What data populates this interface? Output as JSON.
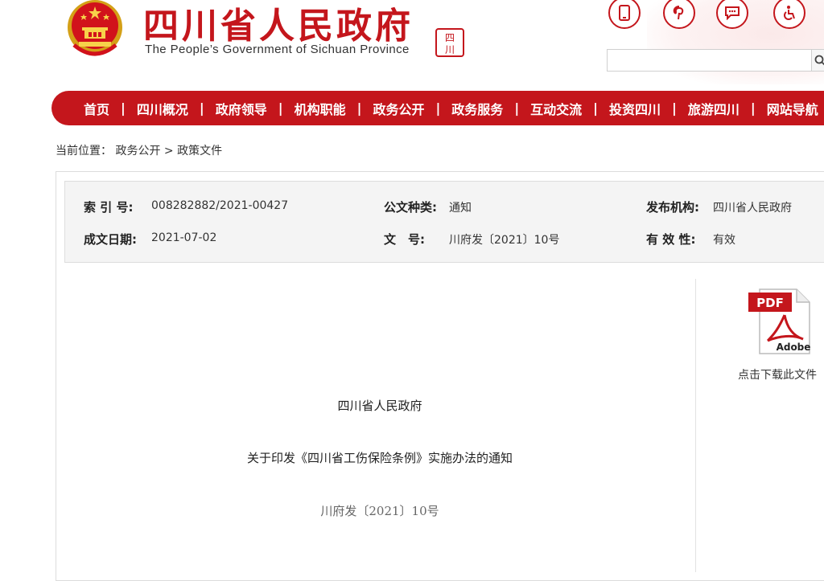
{
  "header": {
    "title": "四川省人民政府",
    "subtitle": "The People’s Government of Sichuan Province",
    "seal_text": "四川",
    "top_icons": [
      "mobile-icon",
      "pinterest-icon",
      "chat-icon",
      "accessibility-icon"
    ],
    "search": {
      "value": "",
      "placeholder": ""
    }
  },
  "nav": {
    "items": [
      "首页",
      "四川概况",
      "政府领导",
      "机构职能",
      "政务公开",
      "政务服务",
      "互动交流",
      "投资四川",
      "旅游四川",
      "网站导航"
    ],
    "separator": "|"
  },
  "breadcrumb": {
    "prefix": "当前位置：",
    "items": [
      "政务公开",
      "政策文件"
    ],
    "separator": ">"
  },
  "meta": {
    "index_label": "索 引 号:",
    "index_value": "008282882/2021-00427",
    "type_label": "公文种类:",
    "type_value": "通知",
    "issuer_label": "发布机构:",
    "issuer_value": "四川省人民政府",
    "date_label": "成文日期:",
    "date_value": "2021-07-02",
    "docno_label": "文　号:",
    "docno_value": "川府发〔2021〕10号",
    "validity_label": "有 效 性:",
    "validity_value": "有效"
  },
  "download": {
    "badge": "PDF",
    "brand": "Adobe",
    "label": "点击下载此文件"
  },
  "document": {
    "issuer": "四川省人民政府",
    "title": "关于印发《四川省工伤保险条例》实施办法的通知",
    "ref": "川府发〔2021〕10号"
  },
  "colors": {
    "brand_red": "#c4161c",
    "meta_bg": "#f4f4f4"
  }
}
